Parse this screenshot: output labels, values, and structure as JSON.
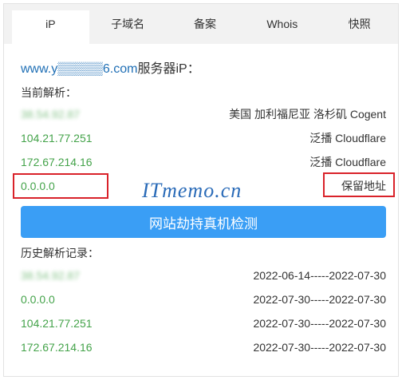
{
  "tabs": [
    "iP",
    "子域名",
    "备案",
    "Whois",
    "快照"
  ],
  "domain_line": {
    "domain": "www.y▒▒▒▒▒6.com",
    "suffix": "服务器iP："
  },
  "current": {
    "label": "当前解析：",
    "rows": [
      {
        "ip": "38.54.92.87",
        "location": "美国 加利福尼亚 洛杉矶 Cogent",
        "blurred": true
      },
      {
        "ip": "104.21.77.251",
        "location": "泛播 Cloudflare",
        "blurred": false
      },
      {
        "ip": "172.67.214.16",
        "location": "泛播 Cloudflare",
        "blurred": false
      },
      {
        "ip": "0.0.0.0",
        "location": "保留地址",
        "blurred": false
      }
    ]
  },
  "watermark": "ITmemo.cn",
  "detect_button": "网站劫持真机检测",
  "history": {
    "label": "历史解析记录：",
    "rows": [
      {
        "ip": "38.54.92.87",
        "date": "2022-06-14-----2022-07-30",
        "blurred": true
      },
      {
        "ip": "0.0.0.0",
        "date": "2022-07-30-----2022-07-30",
        "blurred": false
      },
      {
        "ip": "104.21.77.251",
        "date": "2022-07-30-----2022-07-30",
        "blurred": false
      },
      {
        "ip": "172.67.214.16",
        "date": "2022-07-30-----2022-07-30",
        "blurred": false
      }
    ]
  },
  "colors": {
    "accent": "#3a9ef5",
    "ip_green": "#44a34a",
    "highlight_red": "#d9222a",
    "domain_blue": "#1f6fb5"
  }
}
